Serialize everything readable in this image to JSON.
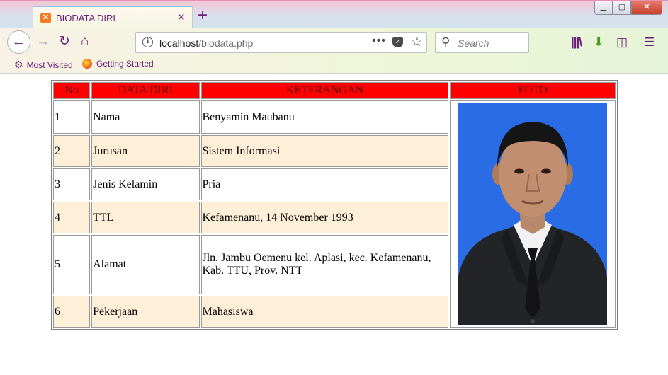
{
  "browser": {
    "tab_title": "BIODATA DIRI",
    "tab_close": "×",
    "new_tab": "+",
    "url_host": "localhost",
    "url_path": "/biodata.php",
    "url_more": "•••",
    "search_placeholder": "Search",
    "bookmarks": {
      "most_visited": "Most Visited",
      "getting_started": "Getting Started"
    }
  },
  "page": {
    "headers": {
      "no": "No",
      "data_diri": "DATA DIRI",
      "keterangan": "KETERANGAN",
      "foto": "FOTO"
    },
    "rows": [
      {
        "no": "1",
        "label": "Nama",
        "value": "Benyamin Maubanu"
      },
      {
        "no": "2",
        "label": "Jurusan",
        "value": "Sistem Informasi"
      },
      {
        "no": "3",
        "label": "Jenis Kelamin",
        "value": "Pria"
      },
      {
        "no": "4",
        "label": "TTL",
        "value": "Kefamenanu, 14 November 1993"
      },
      {
        "no": "5",
        "label": "Alamat",
        "value": "Jln. Jambu Oemenu kel. Aplasi, kec. Kefamenanu, Kab. TTU, Prov. NTT"
      },
      {
        "no": "6",
        "label": "Pekerjaan",
        "value": "Mahasiswa"
      }
    ]
  },
  "colors": {
    "header_red": "#ff0000",
    "row_alt": "#feefd8",
    "photo_bg": "#2a6be6",
    "accent_purple": "#6b1c76"
  }
}
